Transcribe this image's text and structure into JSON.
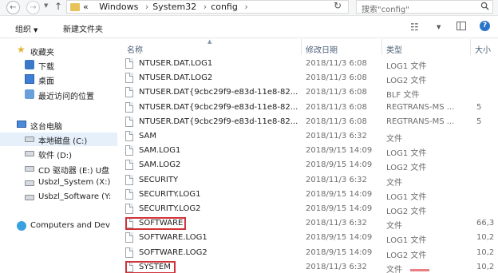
{
  "address_bar": {
    "back_glyph": "←",
    "forward_glyph": "→",
    "up_glyph": "↑",
    "path_prefix": "«",
    "path": [
      "Windows",
      "System32",
      "config"
    ],
    "separator": "›",
    "search_placeholder": "搜索\"config\""
  },
  "toolbar": {
    "organize_label": "组织",
    "organize_caret": "▼",
    "new_folder_label": "新建文件夹",
    "help_glyph": "?"
  },
  "navpane": {
    "favorites_label": "收藏夹",
    "favorites": [
      "下载",
      "桌面",
      "最近访问的位置"
    ],
    "this_pc_label": "这台电脑",
    "drives": [
      "本地磁盘 (C:)",
      "软件 (D:)",
      "CD 驱动器 (E:) U盘",
      "Usbzl_System (X:)",
      "Usbzl_Software (Y:"
    ],
    "network_label": "Computers and Dev"
  },
  "columns": {
    "name": "名称",
    "date": "修改日期",
    "type": "类型",
    "size": "大小"
  },
  "files": [
    {
      "name": "NTUSER.DAT.LOG1",
      "date": "2018/11/3 6:08",
      "type": "LOG1 文件",
      "size": ""
    },
    {
      "name": "NTUSER.DAT.LOG2",
      "date": "2018/11/3 6:08",
      "type": "LOG2 文件",
      "size": ""
    },
    {
      "name": "NTUSER.DAT{9cbc29f9-e83d-11e8-82...",
      "date": "2018/11/3 6:08",
      "type": "BLF 文件",
      "size": ""
    },
    {
      "name": "NTUSER.DAT{9cbc29f9-e83d-11e8-82...",
      "date": "2018/11/3 6:08",
      "type": "REGTRANS-MS ...",
      "size": "5"
    },
    {
      "name": "NTUSER.DAT{9cbc29f9-e83d-11e8-82...",
      "date": "2018/11/3 6:08",
      "type": "REGTRANS-MS ...",
      "size": "5"
    },
    {
      "name": "SAM",
      "date": "2018/11/3 6:32",
      "type": "文件",
      "size": ""
    },
    {
      "name": "SAM.LOG1",
      "date": "2018/9/15 14:09",
      "type": "LOG1 文件",
      "size": ""
    },
    {
      "name": "SAM.LOG2",
      "date": "2018/9/15 14:09",
      "type": "LOG2 文件",
      "size": ""
    },
    {
      "name": "SECURITY",
      "date": "2018/11/3 6:32",
      "type": "文件",
      "size": ""
    },
    {
      "name": "SECURITY.LOG1",
      "date": "2018/9/15 14:09",
      "type": "LOG1 文件",
      "size": ""
    },
    {
      "name": "SECURITY.LOG2",
      "date": "2018/9/15 14:09",
      "type": "LOG2 文件",
      "size": ""
    },
    {
      "name": "SOFTWARE",
      "date": "2018/11/3 6:32",
      "type": "文件",
      "size": "66,3"
    },
    {
      "name": "SOFTWARE.LOG1",
      "date": "2018/9/15 14:09",
      "type": "LOG1 文件",
      "size": "10,2"
    },
    {
      "name": "SOFTWARE.LOG2",
      "date": "2018/9/15 14:09",
      "type": "LOG2 文件",
      "size": "10,2"
    },
    {
      "name": "SYSTEM",
      "date": "2018/11/3 6:32",
      "type": "文件",
      "size": "10,2"
    }
  ],
  "highlighted_files": [
    "SOFTWARE",
    "SYSTEM"
  ],
  "colors": {
    "highlight_border": "#d0333a",
    "selected_nav": "#e5f0fb",
    "header_text": "#4c607a"
  }
}
